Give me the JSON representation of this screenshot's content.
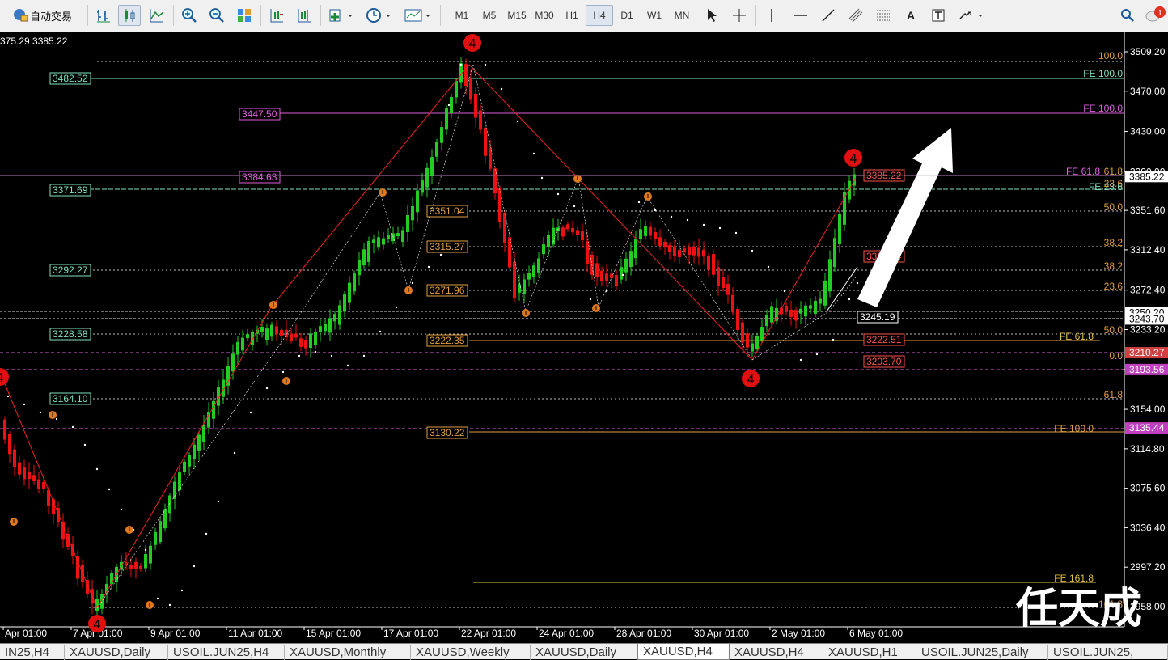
{
  "toolbar": {
    "autotrade_label": "自动交易",
    "timeframes": [
      "M1",
      "M5",
      "M15",
      "M30",
      "H1",
      "H4",
      "D1",
      "W1",
      "MN"
    ],
    "active_timeframe": "H4",
    "notification_count": "1",
    "text_tool": "A"
  },
  "chart": {
    "ohlc_header": "375.29 3385.22",
    "current_price": "3385.22",
    "price_axis": [
      "3509.20",
      "3470.00",
      "3430.00",
      "3390.00",
      "3351.60",
      "3312.40",
      "3272.40",
      "3233.20",
      "3193.56",
      "3154.00",
      "3114.80",
      "3075.60",
      "3036.40",
      "2997.20",
      "2958.00"
    ],
    "price_axis_highlights": [
      {
        "text": "3385.22",
        "bg": "#ffffff",
        "fg": "#000000"
      },
      {
        "text": "3250.20",
        "bg": "#ffffff",
        "fg": "#000000"
      },
      {
        "text": "3243.70",
        "bg": "#ffffff",
        "fg": "#000000"
      },
      {
        "text": "3210.27",
        "bg": "#d04040",
        "fg": "#ffffff"
      },
      {
        "text": "3193.56",
        "bg": "#c040c0",
        "fg": "#ffffff"
      },
      {
        "text": "3135.44",
        "bg": "#c040c0",
        "fg": "#ffffff"
      }
    ],
    "time_axis": [
      "Apr 01:00",
      "7 Apr 01:00",
      "9 Apr 01:00",
      "11 Apr 01:00",
      "15 Apr 01:00",
      "17 Apr 01:00",
      "22 Apr 01:00",
      "24 Apr 01:00",
      "28 Apr 01:00",
      "30 Apr 01:00",
      "2 May 01:00",
      "6 May 01:00"
    ],
    "price_labels": [
      {
        "text": "3482.52",
        "color": "#7fe0c0"
      },
      {
        "text": "3447.50",
        "color": "#e060e0"
      },
      {
        "text": "3384.63",
        "color": "#e060e0"
      },
      {
        "text": "3371.69",
        "color": "#7fe0c0"
      },
      {
        "text": "3351.04",
        "color": "#e0a040"
      },
      {
        "text": "3315.27",
        "color": "#e0a040"
      },
      {
        "text": "3292.27",
        "color": "#7fe0c0"
      },
      {
        "text": "3271.96",
        "color": "#e0a040"
      },
      {
        "text": "3228.58",
        "color": "#7fe0c0"
      },
      {
        "text": "3222.35",
        "color": "#e0a040"
      },
      {
        "text": "3164.10",
        "color": "#7fe0c0"
      },
      {
        "text": "3130.22",
        "color": "#e0a040"
      },
      {
        "text": "3385.22",
        "color": "#ff5050"
      },
      {
        "text": "3300.44",
        "color": "#ff5050"
      },
      {
        "text": "3245.19",
        "color": "#ffffff"
      },
      {
        "text": "3222.51",
        "color": "#ff5050"
      },
      {
        "text": "3203.70",
        "color": "#ff5050"
      }
    ],
    "fib_labels": [
      {
        "text": "100.0",
        "color": "#e0a040"
      },
      {
        "text": "FE 100.0",
        "color": "#7fe0c0"
      },
      {
        "text": "FE 100.0",
        "color": "#e060e0"
      },
      {
        "text": "61.8",
        "color": "#e0a040"
      },
      {
        "text": "FE 61.8",
        "color": "#e060e0"
      },
      {
        "text": "23.6",
        "color": "#e0a040"
      },
      {
        "text": "FE 23.6",
        "color": "#7fe0c0"
      },
      {
        "text": "50.0",
        "color": "#e0a040"
      },
      {
        "text": "38.2",
        "color": "#e0a040"
      },
      {
        "text": "38.2",
        "color": "#e0a040"
      },
      {
        "text": "23.6",
        "color": "#e0a040"
      },
      {
        "text": "50.0",
        "color": "#e0a040"
      },
      {
        "text": "FE 61.8",
        "color": "#e0c040"
      },
      {
        "text": "0.0",
        "color": "#e0a040"
      },
      {
        "text": "61.8",
        "color": "#e0a040"
      },
      {
        "text": "FE 100.0",
        "color": "#e0a040"
      },
      {
        "text": "FE 161.8",
        "color": "#e0c040"
      },
      {
        "text": "161.8",
        "color": "#e0a040"
      }
    ],
    "wave_labels": [
      "4",
      "4",
      "4",
      "4",
      "4"
    ],
    "watermark": "任天成",
    "colors": {
      "bull": "#22cc22",
      "bear": "#ee1111",
      "zigzag": "#ee2222",
      "background": "#000000",
      "grid_text": "#ffffff"
    }
  },
  "tabs": [
    "IN25,H4",
    "XAUUSD,Daily",
    "USOIL.JUN25,H4",
    "XAUUSD,Monthly",
    "XAUUSD,Weekly",
    "XAUUSD,Daily",
    "XAUUSD,H4",
    "XAUUSD,H4",
    "XAUUSD,H1",
    "USOIL.JUN25,Daily",
    "USOIL.JUN25,"
  ],
  "active_tab": "XAUUSD,H4"
}
